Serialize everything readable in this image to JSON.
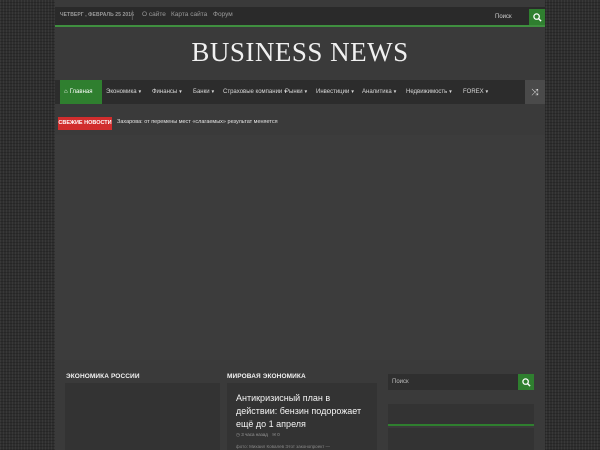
{
  "topbar": {
    "date": "ЧЕТВЕРГ , ФЕВРАЛЬ 25 2016",
    "links": [
      "О сайте",
      "Карта сайта",
      "Форум"
    ],
    "search_placeholder": "Поиск"
  },
  "header": {
    "logo": "BUSINESS NEWS"
  },
  "nav": {
    "home": "Главная",
    "items": [
      "Экономика",
      "Финансы",
      "Банки",
      "Страховые компании",
      "Рынки",
      "Инвестиции",
      "Аналитика",
      "Недвижимость",
      "FOREX"
    ]
  },
  "breaking": {
    "label": "СВЕЖИЕ НОВОСТИ",
    "text": "Захарова: от перемены мест «слагаемых» результат меняется"
  },
  "sections": {
    "economy_russia": "ЭКОНОМИКА РОССИИ",
    "world_economy": "МИРОВАЯ ЭКОНОМИКА"
  },
  "article": {
    "title": "Антикризисный план в действии: бензин подорожает ещё до 1 апреля",
    "time": "3 часа назад",
    "comments": "0",
    "excerpt": "фото: Михаил Ковалев Этот законопроект —"
  },
  "sidebar": {
    "search_placeholder": "Поиск"
  },
  "colors": {
    "accent": "#2f7f2f",
    "breaking": "#d12d2d"
  }
}
